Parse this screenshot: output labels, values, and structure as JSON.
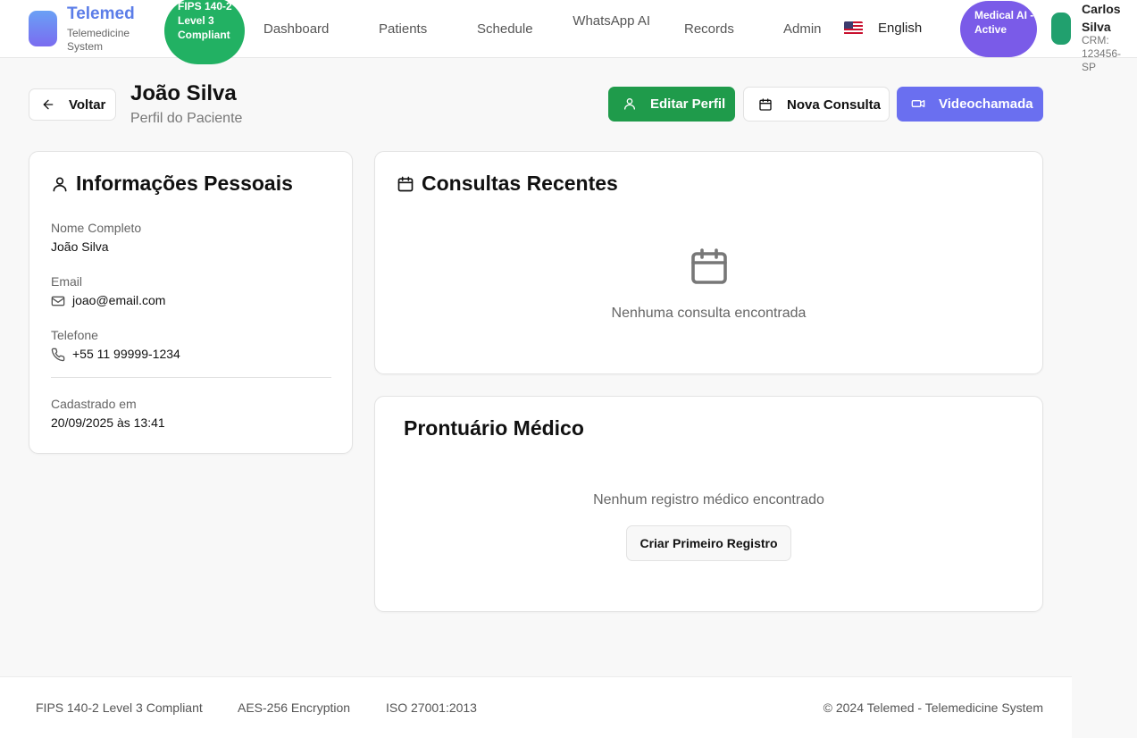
{
  "header": {
    "brand_title": "Telemed",
    "brand_subtitle": "Telemedicine System",
    "compliance_badge": "FIPS 140-2 Level 3 Compliant",
    "nav": [
      "Dashboard",
      "Patients",
      "Schedule",
      "WhatsApp AI",
      "Records",
      "Admin"
    ],
    "language": "English",
    "ai_status": "Medical AI - Active",
    "user_name": "Carlos Silva",
    "user_crm": "CRM: 123456-SP"
  },
  "page": {
    "back_label": "Voltar",
    "title": "João Silva",
    "subtitle": "Perfil do Paciente",
    "edit_label": "Editar Perfil",
    "new_consult_label": "Nova Consulta",
    "video_label": "Videochamada"
  },
  "personal": {
    "title": "Informações Pessoais",
    "name_label": "Nome Completo",
    "name_value": "João Silva",
    "email_label": "Email",
    "email_value": "joao@email.com",
    "phone_label": "Telefone",
    "phone_value": "+55 11 99999-1234",
    "registered_label": "Cadastrado em",
    "registered_value": "20/09/2025 às 13:41"
  },
  "consultations": {
    "title": "Consultas Recentes",
    "empty_text": "Nenhuma consulta encontrada"
  },
  "records": {
    "title": "Prontuário Médico",
    "empty_text": "Nenhum registro médico encontrado",
    "create_label": "Criar Primeiro Registro"
  },
  "footer": {
    "fips": "FIPS 140-2 Level 3 Compliant",
    "aes": "AES-256 Encryption",
    "iso": "ISO 27001:2013",
    "copyright": "© 2024 Telemed - Telemedicine System"
  },
  "colors": {
    "brand": "#5b7de8",
    "success": "#1f9b4b",
    "video": "#6a6ff0",
    "ai_badge": "#7a5be8"
  }
}
